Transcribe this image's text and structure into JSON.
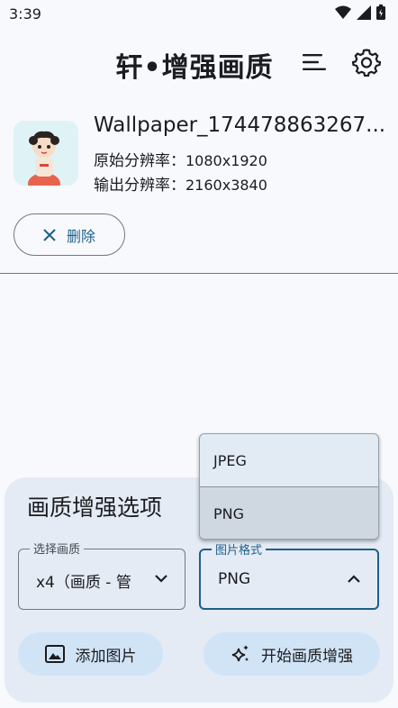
{
  "status_bar": {
    "time": "3:39",
    "icons": [
      "wifi-icon",
      "signal-icon",
      "battery-icon"
    ]
  },
  "header": {
    "title": "轩•增强画质",
    "menu_icon": "sort-icon",
    "settings_icon": "gear-icon"
  },
  "image": {
    "file_name": "Wallpaper_174478863267...",
    "original_label": "原始分辨率：",
    "original_value": "1080x1920",
    "output_label": "输出分辨率：",
    "output_value": "2160x3840"
  },
  "delete_button": {
    "label": "删除",
    "icon": "close-icon"
  },
  "panel": {
    "title": "画质增强选项",
    "quality": {
      "label": "选择画质",
      "value": "x4（画质 - 管"
    },
    "format": {
      "label": "图片格式",
      "value": "PNG"
    },
    "add_button": {
      "label": "添加图片",
      "icon": "image-icon"
    },
    "start_button": {
      "label": "开始画质增强",
      "icon": "sparkle-icon"
    }
  },
  "dropdown": {
    "options": [
      "JPEG",
      "PNG"
    ],
    "selected": "PNG"
  },
  "colors": {
    "accent": "#1d5f8a",
    "panel_bg": "#e4ebf4",
    "button_bg": "#d1e4f6"
  }
}
